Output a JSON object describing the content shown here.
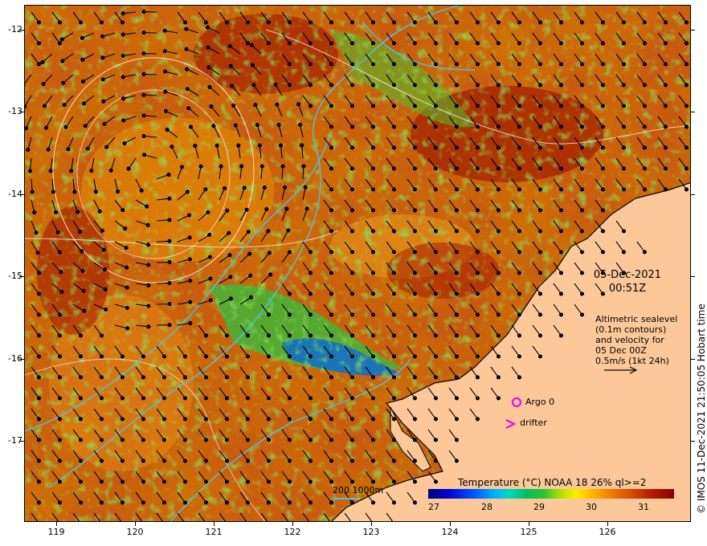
{
  "map": {
    "lat_ticks": [
      "-12",
      "-13",
      "-14",
      "-15",
      "-16",
      "-17"
    ],
    "lon_ticks": [
      "119",
      "120",
      "121",
      "122",
      "123",
      "124",
      "125",
      "126"
    ],
    "date_line1": "05-Dec-2021",
    "date_line2": "00:51Z",
    "info_lines": [
      "Altimetric sealevel",
      "(0.1m contours)",
      "and velocity for",
      "05 Dec 00Z",
      "0.5m/s (1kt 24h)"
    ],
    "argo_label": "Argo 0",
    "drifter_label": "drifter",
    "depth_legend": "200  1000m",
    "credit": "© IMOS 11-Dec-2021 21:50:05 Hobart time",
    "colors": {
      "land": "#fcc89a",
      "coast": "#000000",
      "isobath": "#4fc3e0",
      "contour": "#ffffff",
      "argo": "#e020e0"
    }
  },
  "colorbar": {
    "title": "Temperature (°C) NOAA 18 26% ql>=2",
    "ticks": [
      "27",
      "28",
      "29",
      "30",
      "31"
    ]
  }
}
